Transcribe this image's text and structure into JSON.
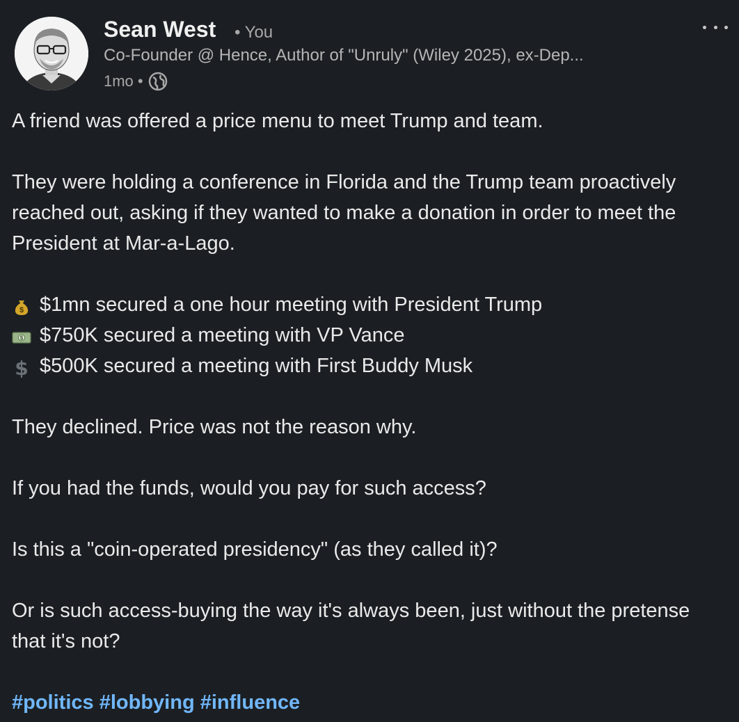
{
  "author": {
    "name": "Sean West",
    "meta": "• You",
    "headline": "Co-Founder @ Hence, Author of \"Unruly\" (Wiley 2025), ex-Dep...",
    "time": "1mo •",
    "avatar_icon": "person-portrait-icon",
    "visibility_icon": "globe-icon"
  },
  "menu_icon": "more-options-icon",
  "post": {
    "line1": "A friend was offered a price menu to meet Trump and team.",
    "para2": "They were holding a conference in Florida and the Trump team proactively reached out, asking if they wanted to make a donation in order to meet the President at Mar-a-Lago.",
    "list": [
      {
        "icon": "money-bag-icon",
        "text": "$1mn secured a one hour meeting with President Trump"
      },
      {
        "icon": "dollar-banknote-icon",
        "text": "$750K secured a meeting with VP Vance"
      },
      {
        "icon": "dollar-sign-icon",
        "text": "$500K secured a meeting with First Buddy Musk"
      }
    ],
    "para4": "They declined. Price was not the reason why.",
    "para5": "If you had the funds, would you pay for such access?",
    "para6": "Is this a \"coin-operated presidency\" (as they called it)?",
    "para7": "Or is such access-buying the way it's always been, just without the pretense that it's not?",
    "hashtags": [
      "#politics",
      "#lobbying",
      "#influence"
    ]
  },
  "colors": {
    "background": "#1b1f23",
    "hashtag": "#71b7fb",
    "text": "#eaeaea",
    "muted": "#a8a8a8"
  }
}
